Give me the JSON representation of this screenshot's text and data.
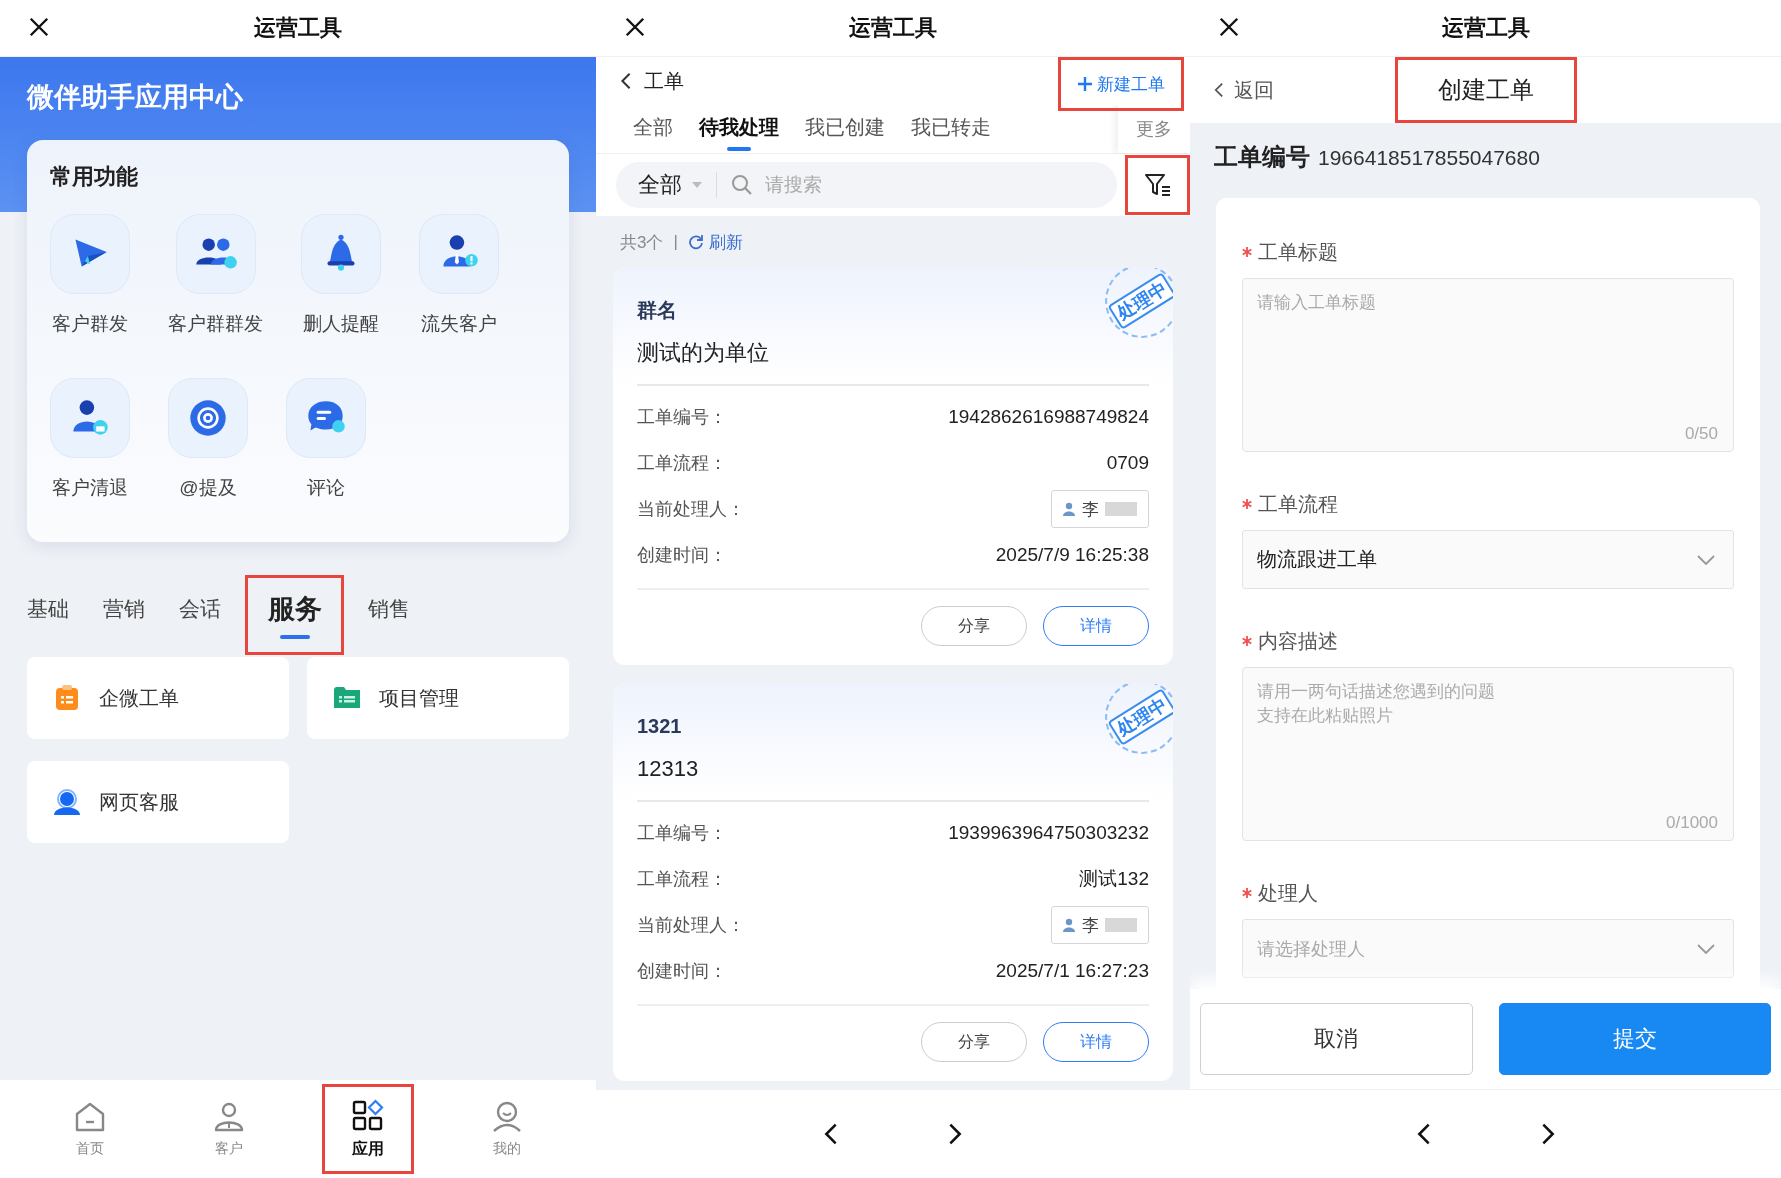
{
  "app_center": {
    "header": {
      "title": "运营工具"
    },
    "banner_title": "微伴助手应用中心",
    "quick_functions": {
      "title": "常用功能",
      "items": [
        {
          "label": "客户群发"
        },
        {
          "label": "客户群群发"
        },
        {
          "label": "删人提醒"
        },
        {
          "label": "流失客户"
        },
        {
          "label": "客户清退"
        },
        {
          "label": "@提及"
        },
        {
          "label": "评论"
        }
      ]
    },
    "category_tabs": [
      {
        "label": "基础",
        "selected": false,
        "highlighted": false
      },
      {
        "label": "营销",
        "selected": false,
        "highlighted": false
      },
      {
        "label": "会话",
        "selected": false,
        "highlighted": false
      },
      {
        "label": "服务",
        "selected": true,
        "highlighted": true
      },
      {
        "label": "销售",
        "selected": false,
        "highlighted": false
      }
    ],
    "services": [
      {
        "label": "企微工单"
      },
      {
        "label": "项目管理"
      },
      {
        "label": "网页客服"
      }
    ],
    "bottom_nav": [
      {
        "label": "首页",
        "selected": false,
        "highlighted": false
      },
      {
        "label": "客户",
        "selected": false,
        "highlighted": false
      },
      {
        "label": "应用",
        "selected": true,
        "highlighted": true
      },
      {
        "label": "我的",
        "selected": false,
        "highlighted": false
      }
    ]
  },
  "ticket_list": {
    "header": {
      "title": "运营工具"
    },
    "back_label": "工单",
    "new_button": {
      "label": "新建工单",
      "highlighted": true
    },
    "tabs": [
      {
        "label": "全部",
        "selected": false
      },
      {
        "label": "待我处理",
        "selected": true
      },
      {
        "label": "我已创建",
        "selected": false
      },
      {
        "label": "我已转走",
        "selected": false
      }
    ],
    "more_label": "更多",
    "scope": "全部",
    "search": {
      "placeholder": "请搜索"
    },
    "filter_highlighted": true,
    "count": "共3个",
    "separator": "|",
    "refresh": "刷新",
    "tickets": [
      {
        "group": "群名",
        "title": "测试的为单位",
        "status": "处理中",
        "fields": [
          {
            "kind": "text",
            "label": "工单编号：",
            "value": "1942862616988749824"
          },
          {
            "kind": "text",
            "label": "工单流程：",
            "value": "0709"
          },
          {
            "kind": "person",
            "label": "当前处理人：",
            "value": "李"
          },
          {
            "kind": "text",
            "label": "创建时间：",
            "value": "2025/7/9 16:25:38"
          }
        ],
        "actions": [
          "分享",
          "详情"
        ]
      },
      {
        "group": "1321",
        "title": "12313",
        "status": "处理中",
        "fields": [
          {
            "kind": "text",
            "label": "工单编号：",
            "value": "1939963964750303232"
          },
          {
            "kind": "text",
            "label": "工单流程：",
            "value": "测试132"
          },
          {
            "kind": "person",
            "label": "当前处理人：",
            "value": "李"
          },
          {
            "kind": "text",
            "label": "创建时间：",
            "value": "2025/7/1 16:27:23"
          }
        ],
        "actions": [
          "分享",
          "详情"
        ]
      }
    ]
  },
  "create_ticket": {
    "header": {
      "title": "运营工具"
    },
    "back_label": "返回",
    "page_title": {
      "text": "创建工单",
      "highlighted": true
    },
    "ticket_no_label": "工单编号",
    "ticket_no": "1966418517855047680",
    "fields": [
      {
        "kind": "textarea",
        "label": "工单标题",
        "required": true,
        "placeholder": "请输入工单标题",
        "counter": "0/50"
      },
      {
        "kind": "select",
        "label": "工单流程",
        "required": true,
        "value": "物流跟进工单"
      },
      {
        "kind": "textarea",
        "label": "内容描述",
        "required": true,
        "placeholder": "请用一两句话描述您遇到的问题支持在此粘贴照片",
        "counter": "0/1000"
      },
      {
        "kind": "select",
        "label": "处理人",
        "required": true,
        "placeholder": "请选择处理人"
      }
    ],
    "buttons": [
      {
        "kind": "secondary",
        "label": "取消"
      },
      {
        "kind": "primary",
        "label": "提交"
      }
    ]
  }
}
